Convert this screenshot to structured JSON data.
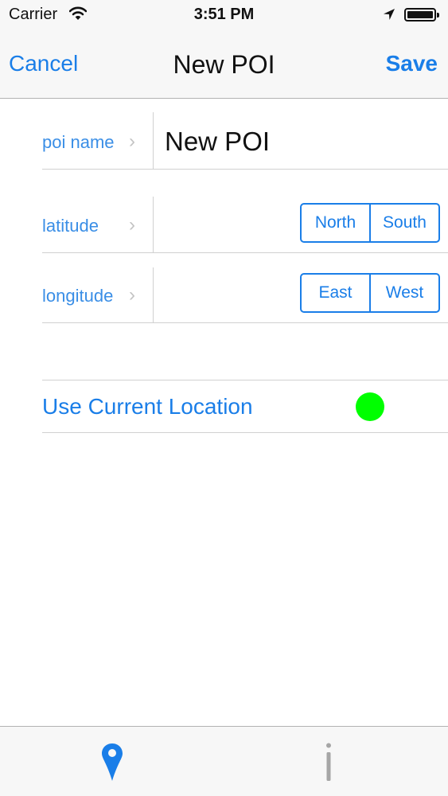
{
  "status_bar": {
    "carrier": "Carrier",
    "time": "3:51 PM",
    "icons": [
      "wifi-icon",
      "location-arrow-icon",
      "battery-icon"
    ]
  },
  "nav": {
    "cancel_label": "Cancel",
    "title": "New POI",
    "save_label": "Save"
  },
  "form": {
    "poi_name": {
      "label": "poi name",
      "value": "New POI"
    },
    "latitude": {
      "label": "latitude",
      "value": "",
      "options": [
        "North",
        "South"
      ]
    },
    "longitude": {
      "label": "longitude",
      "value": "",
      "options": [
        "East",
        "West"
      ]
    }
  },
  "location": {
    "label": "Use Current Location",
    "indicator_color": "#00ff00"
  },
  "tab_bar": {
    "items": [
      {
        "icon": "map-pin-icon",
        "color": "#1a7ee8"
      },
      {
        "icon": "info-icon",
        "color": "#a6a6a6"
      }
    ]
  },
  "colors": {
    "accent": "#1a7ee8",
    "label": "#3a8ee6",
    "bar_background": "#f7f7f7"
  }
}
